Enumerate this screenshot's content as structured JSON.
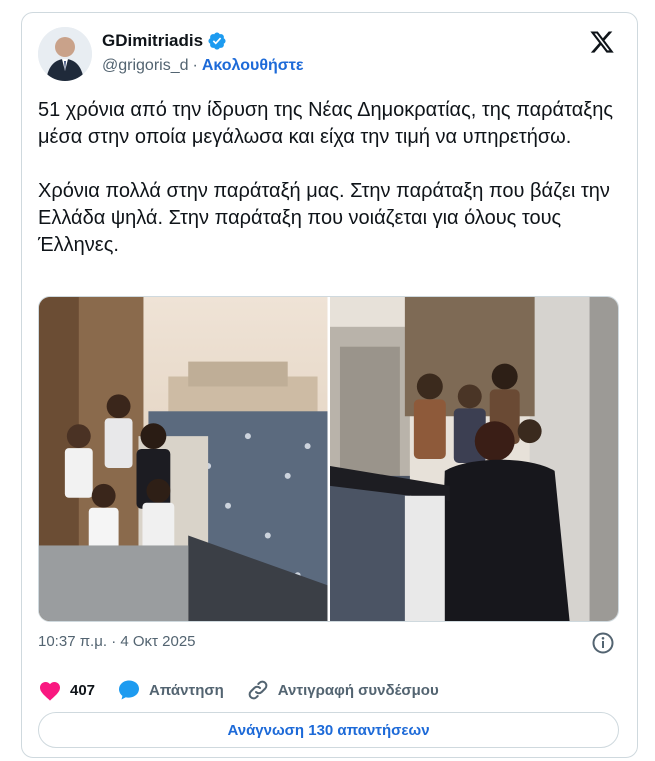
{
  "author": {
    "display_name": "GDimitriadis",
    "handle": "@grigoris_d",
    "separator": "·",
    "follow_label": "Ακολουθήστε"
  },
  "tweet": {
    "text": "51 χρόνια από την ίδρυση της Νέας Δημοκρατίας, της παράταξης μέσα στην οποία μεγάλωσα και είχα την τιμή να υπηρετήσω.\n\nΧρόνια πολλά στην παράταξή μας. Στην παράταξη που βάζει την Ελλάδα ψηλά. Στην παράταξη που νοιάζεται για όλους τους Έλληνες.",
    "timestamp": "10:37 π.μ. · 4 Οκτ 2025"
  },
  "actions": {
    "like_count": "407",
    "reply_label": "Απάντηση",
    "copy_link_label": "Αντιγραφή συνδέσμου"
  },
  "read_replies_label": "Ανάγνωση 130 απαντήσεων",
  "colors": {
    "accent": "#1d6ad8",
    "verified": "#1d9bf0",
    "like": "#f91880",
    "muted": "#536471"
  },
  "icons": [
    "x-logo-icon",
    "verified-badge-icon",
    "info-icon",
    "heart-icon",
    "reply-bubble-icon",
    "link-icon"
  ]
}
